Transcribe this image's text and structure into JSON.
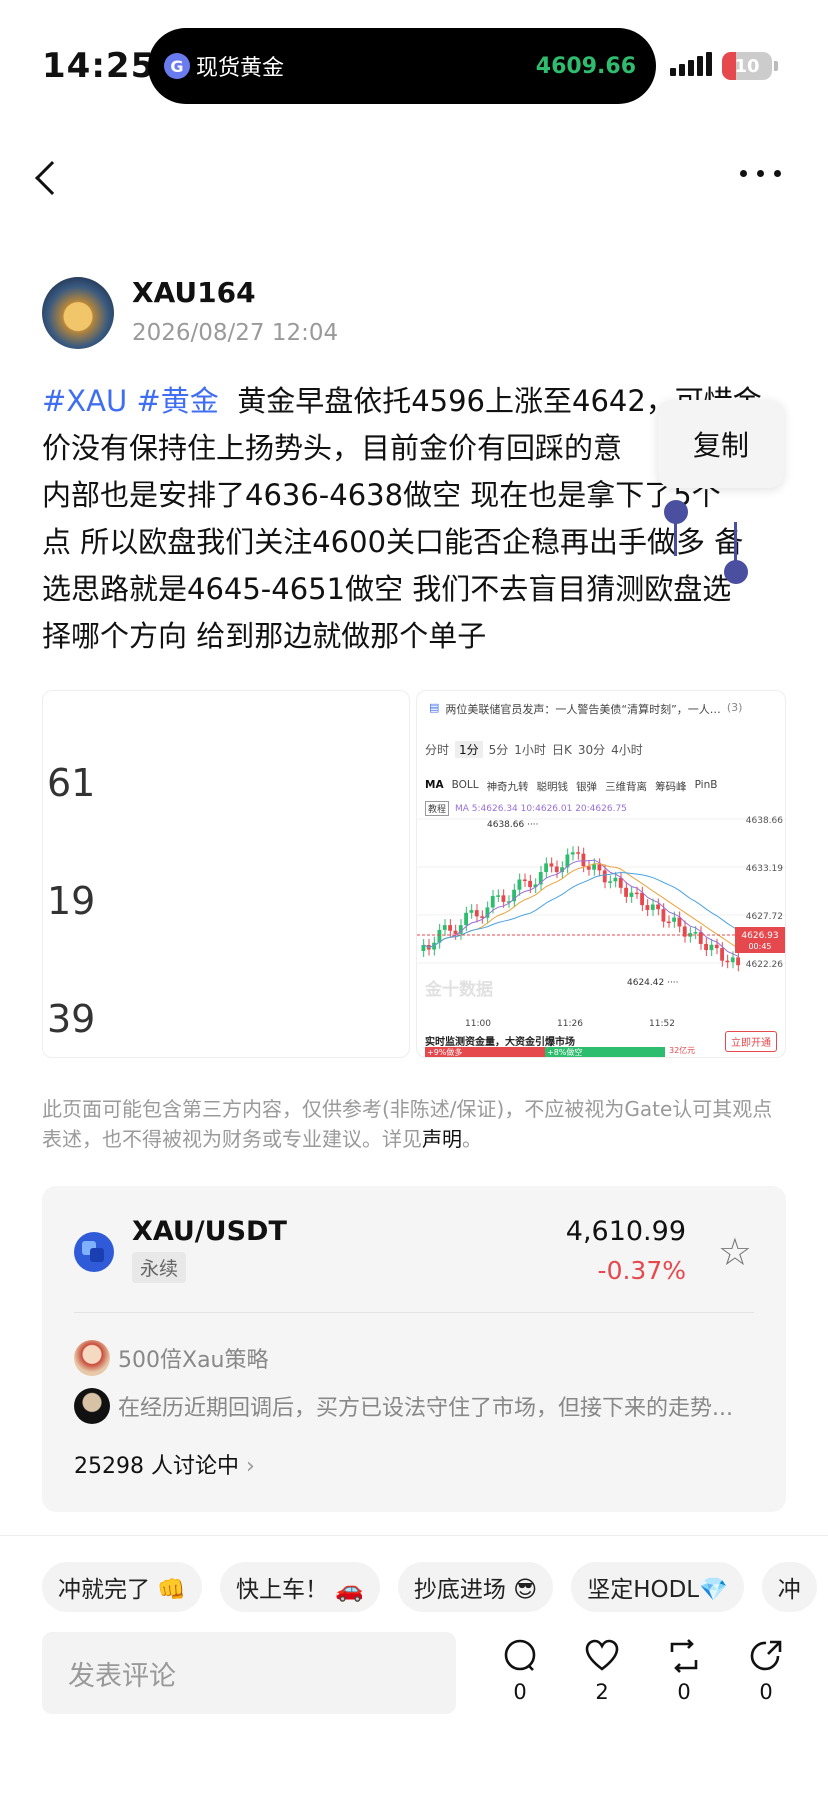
{
  "status": {
    "time": "14:25",
    "island_label": "现货黄金",
    "island_price": "4609.66",
    "battery": "10"
  },
  "post": {
    "author": "XAU164",
    "date": "2026/08/27 12:04",
    "tags": [
      "#XAU",
      "#黄金"
    ],
    "text_lines": [
      "黄金早盘依托4596上涨至4642，可惜金",
      "价没有保持住上扬势头，目前金价有回踩的意",
      "内部也是安排了4636-4638做空 现在也是拿下了5个",
      "点 所以欧盘我们关注4600关口能否企稳再出手做多 备",
      "选思路就是4645-4651做空 我们不去盲目猜测欧盘选",
      "择哪个方向 给到那边就做那个单子"
    ],
    "copy_label": "复制"
  },
  "image_left": {
    "numbers": [
      "61",
      "19",
      "39"
    ]
  },
  "image_right": {
    "headline": "两位美联储官员发声：一人警告美债“清算时刻”，一人…",
    "headline_count": "(3)",
    "tabs": [
      "分时",
      "1分",
      "5分",
      "1小时",
      "日K",
      "30分",
      "4小时"
    ],
    "indicators": [
      "MA",
      "BOLL",
      "神奇九转",
      "聪明钱",
      "银弹",
      "三维背离",
      "筹码峰",
      "PinB"
    ],
    "ma_tag": "教程",
    "ma_text": "MA 5:4626.34 10:4626.01 20:4626.75",
    "y_ticks": [
      "4638.66",
      "4633.19",
      "4627.72",
      "4622.26"
    ],
    "current_price": "4626.93",
    "countdown": "00:45",
    "high_label": "4638.66",
    "low_label": "4624.42",
    "x_ticks": [
      "11:00",
      "11:26",
      "11:52"
    ],
    "watermark": "金十数据",
    "banner": "实时监测资金量，大资金引爆市场",
    "bar_left": "+9%做多",
    "bar_right": "+8%做空",
    "bar_extra": "32亿元",
    "cta": "立即开通"
  },
  "disclaimer": {
    "text": "此页面可能包含第三方内容，仅供参考(非陈述/保证)，不应被视为Gate认可其观点表述，也不得被视为财务或专业建议。详见",
    "link": "声明",
    "end": "。"
  },
  "market": {
    "pair": "XAU/USDT",
    "type": "永续",
    "price": "4,610.99",
    "change": "-0.37%",
    "user1": "500倍Xau策略",
    "snippet": "在经历近期回调后，买方已设法守住了市场，但接下来的走势...",
    "discussion": "25298 人讨论中"
  },
  "chips": [
    "冲就完了 👊",
    "快上车！ 🚗",
    "抄底进场 😎",
    "坚定HODL💎",
    "冲"
  ],
  "comment_placeholder": "发表评论",
  "actions": {
    "comments": "0",
    "likes": "2",
    "reposts": "0",
    "shares": "0"
  },
  "colors": {
    "accent": "#3f6ef2",
    "down": "#e5484d",
    "up": "#2ebd6e"
  }
}
